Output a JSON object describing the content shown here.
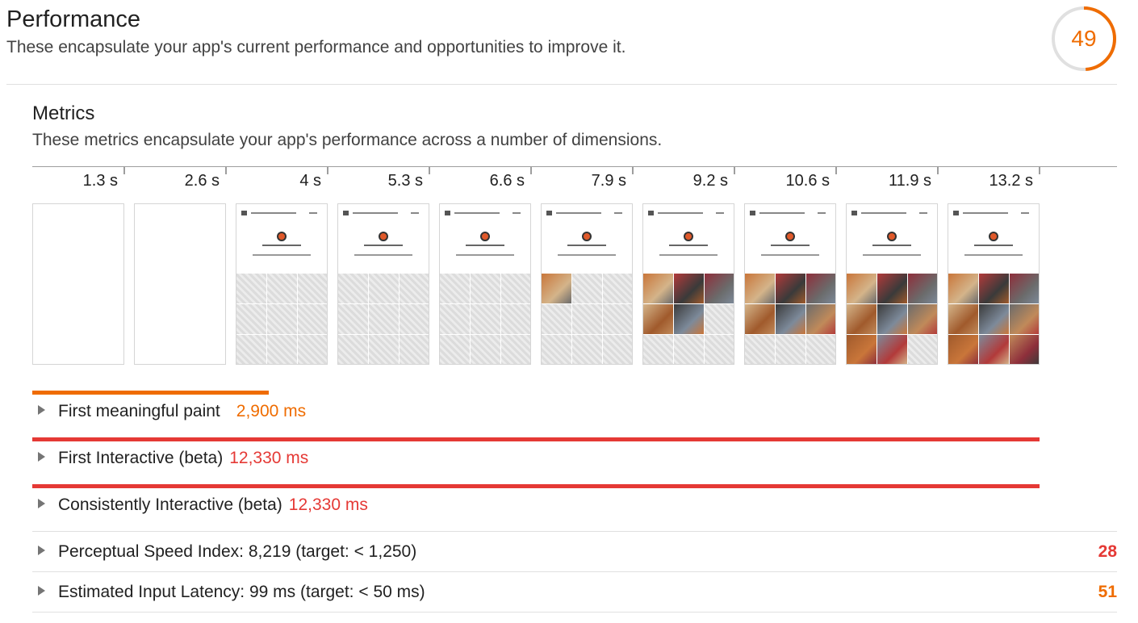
{
  "performance": {
    "title": "Performance",
    "description": "These encapsulate your app's current performance and opportunities to improve it.",
    "score": "49",
    "score_fraction": 0.49,
    "score_color": "#ef6c00"
  },
  "metrics": {
    "title": "Metrics",
    "description": "These metrics encapsulate your app's performance across a number of dimensions."
  },
  "timeline": {
    "ticks": [
      "1.3 s",
      "2.6 s",
      "4 s",
      "5.3 s",
      "6.6 s",
      "7.9 s",
      "9.2 s",
      "10.6 s",
      "11.9 s",
      "13.2 s"
    ],
    "frames_loaded_images": [
      0,
      0,
      0,
      0,
      0,
      1,
      5,
      6,
      8,
      9
    ],
    "frames_has_content": [
      false,
      false,
      true,
      true,
      true,
      true,
      true,
      true,
      true,
      true
    ]
  },
  "metric_rows": [
    {
      "name": "First meaningful paint",
      "value": "2,900 ms",
      "color": "#ef6c00",
      "bar_fraction": 0.2199
    },
    {
      "name": "First Interactive (beta)",
      "value": "12,330 ms",
      "color": "#e53935",
      "bar_fraction": 0.9358
    },
    {
      "name": "Consistently Interactive (beta)",
      "value": "12,330 ms",
      "color": "#e53935",
      "bar_fraction": 0.9358
    }
  ],
  "audits": [
    {
      "text": "Perceptual Speed Index: 8,219 (target: < 1,250)",
      "score": "28",
      "color": "#e53935"
    },
    {
      "text": "Estimated Input Latency: 99 ms (target: < 50 ms)",
      "score": "51",
      "color": "#ef6c00"
    }
  ]
}
